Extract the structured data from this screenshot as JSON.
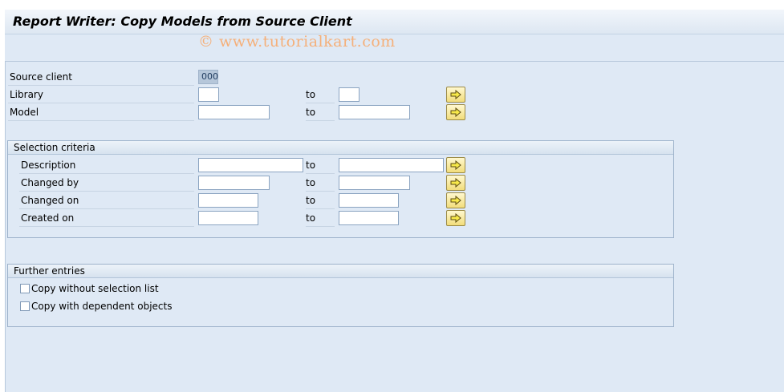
{
  "title": "Report Writer: Copy Models from Source Client",
  "watermark": "© www.tutorialkart.com",
  "source_client": {
    "label": "Source client",
    "value": "000"
  },
  "library": {
    "label": "Library",
    "to": "to",
    "from_value": "",
    "to_value": ""
  },
  "model": {
    "label": "Model",
    "to": "to",
    "from_value": "",
    "to_value": ""
  },
  "selection_criteria": {
    "title": "Selection criteria",
    "description": {
      "label": "Description",
      "to": "to"
    },
    "changed_by": {
      "label": "Changed by",
      "to": "to"
    },
    "changed_on": {
      "label": "Changed on",
      "to": "to"
    },
    "created_on": {
      "label": "Created on",
      "to": "to"
    }
  },
  "further_entries": {
    "title": "Further entries",
    "copy_without_selection_list": {
      "label": "Copy without selection list",
      "checked": false
    },
    "copy_with_dependent_objects": {
      "label": "Copy with dependent objects",
      "checked": false
    }
  },
  "icons": {
    "multiple_selection": "arrow-right-icon"
  },
  "colors": {
    "background": "#dfe9f5",
    "button": "#f2dd7b",
    "watermark": "#f5b07a"
  }
}
